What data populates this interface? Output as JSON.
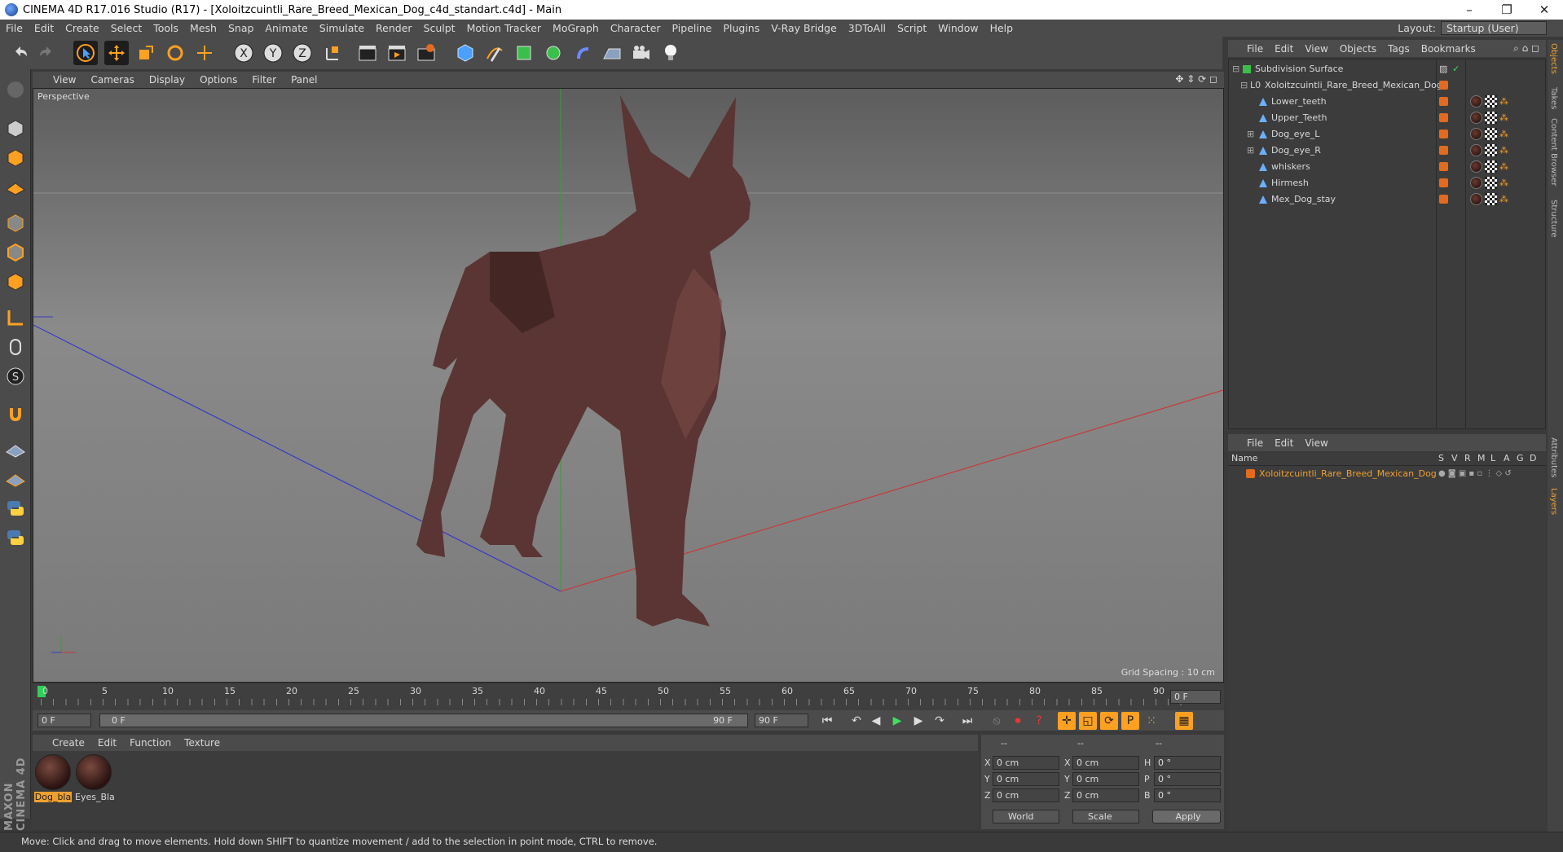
{
  "window": {
    "title": "CINEMA 4D R17.016 Studio (R17) - [Xoloitzcuintli_Rare_Breed_Mexican_Dog_c4d_standart.c4d] - Main",
    "minimize": "–",
    "restore": "❐",
    "close": "✕"
  },
  "menu": [
    "File",
    "Edit",
    "Create",
    "Select",
    "Tools",
    "Mesh",
    "Snap",
    "Animate",
    "Simulate",
    "Render",
    "Sculpt",
    "Motion Tracker",
    "MoGraph",
    "Character",
    "Pipeline",
    "Plugins",
    "V-Ray Bridge",
    "3DToAll",
    "Script",
    "Window",
    "Help"
  ],
  "layout": {
    "label": "Layout:",
    "value": "Startup (User)"
  },
  "viewport": {
    "menu": [
      "View",
      "Cameras",
      "Display",
      "Options",
      "Filter",
      "Panel"
    ],
    "label": "Perspective",
    "grid_spacing": "Grid Spacing : 10 cm"
  },
  "timeline": {
    "ticks": [
      "0",
      "5",
      "10",
      "15",
      "20",
      "25",
      "30",
      "35",
      "40",
      "45",
      "50",
      "55",
      "60",
      "65",
      "70",
      "75",
      "80",
      "85",
      "90"
    ],
    "current_frame": "0 F",
    "start_field": "0 F",
    "range_start": "0 F",
    "range_end": "90 F",
    "end_field": "90 F"
  },
  "materials": {
    "menu": [
      "Create",
      "Edit",
      "Function",
      "Texture"
    ],
    "items": [
      {
        "name": "Dog_bla"
      },
      {
        "name": "Eyes_Bla"
      }
    ]
  },
  "coords": {
    "headers": [
      "--",
      "--",
      "--"
    ],
    "rows": [
      {
        "a": "X",
        "av": "0 cm",
        "b": "X",
        "bv": "0 cm",
        "c": "H",
        "cv": "0 °"
      },
      {
        "a": "Y",
        "av": "0 cm",
        "b": "Y",
        "bv": "0 cm",
        "c": "P",
        "cv": "0 °"
      },
      {
        "a": "Z",
        "av": "0 cm",
        "b": "Z",
        "bv": "0 cm",
        "c": "B",
        "cv": "0 °"
      }
    ],
    "mode": "World",
    "scale": "Scale",
    "apply": "Apply"
  },
  "objects": {
    "menu": [
      "File",
      "Edit",
      "View",
      "Objects",
      "Tags",
      "Bookmarks"
    ],
    "items": [
      {
        "name": "Subdivision Surface"
      },
      {
        "name": "Xoloitzcuintli_Rare_Breed_Mexican_Dog"
      },
      {
        "name": "Lower_teeth"
      },
      {
        "name": "Upper_Teeth"
      },
      {
        "name": "Dog_eye_L"
      },
      {
        "name": "Dog_eye_R"
      },
      {
        "name": "whiskers"
      },
      {
        "name": "Hirmesh"
      },
      {
        "name": "Mex_Dog_stay"
      }
    ]
  },
  "layers": {
    "menu": [
      "File",
      "Edit",
      "View"
    ],
    "columns": [
      "Name",
      "S",
      "V",
      "R",
      "M",
      "L",
      "A",
      "G",
      "D"
    ],
    "items": [
      {
        "name": "Xoloitzcuintli_Rare_Breed_Mexican_Dog"
      }
    ]
  },
  "side_tabs": [
    "Objects",
    "Takes",
    "Content Browser",
    "Structure",
    "Attributes",
    "Layers"
  ],
  "brand": "MAXON CINEMA 4D",
  "status": "Move: Click and drag to move elements. Hold down SHIFT to quantize movement / add to the selection in point mode, CTRL to remove.",
  "colors": {
    "accent": "#e36a1e",
    "selected": "#f0a030",
    "bg": "#4b4b4b"
  }
}
